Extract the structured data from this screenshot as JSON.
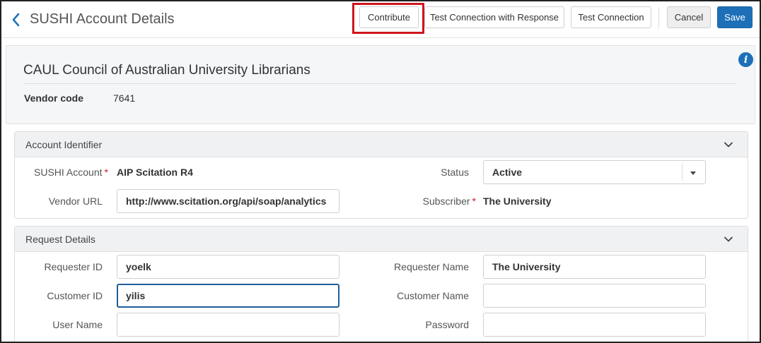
{
  "header": {
    "title": "SUSHI Account Details",
    "buttons": {
      "contribute": "Contribute",
      "test_connection_with_response": "Test Connection with Response",
      "test_connection": "Test Connection",
      "cancel": "Cancel",
      "save": "Save"
    }
  },
  "vendor": {
    "name": "CAUL Council of Australian University Librarians",
    "code_label": "Vendor code",
    "code_value": "7641",
    "info_icon": "i"
  },
  "account_identifier": {
    "title": "Account Identifier",
    "sushi_account_label": "SUSHI Account",
    "sushi_account_value": "AIP Scitation R4",
    "status_label": "Status",
    "status_value": "Active",
    "vendor_url_label": "Vendor URL",
    "vendor_url_value": "http://www.scitation.org/api/soap/analytics",
    "subscriber_label": "Subscriber",
    "subscriber_value": "The University",
    "required_mark": "*"
  },
  "request_details": {
    "title": "Request Details",
    "requester_id_label": "Requester ID",
    "requester_id_value": "yoelk",
    "requester_name_label": "Requester Name",
    "requester_name_value": "The University",
    "customer_id_label": "Customer ID",
    "customer_id_value": "yilis",
    "customer_name_label": "Customer Name",
    "customer_name_value": "",
    "user_name_label": "User Name",
    "user_name_value": "",
    "password_label": "Password",
    "password_value": ""
  },
  "icons": [
    "back-chevron-icon",
    "info-icon",
    "chevron-down-icon",
    "dropdown-caret-icon"
  ],
  "colors": {
    "primary": "#1d70b8",
    "highlight": "#d0151f",
    "required": "#d0151f",
    "focus": "#1d5f9a"
  }
}
